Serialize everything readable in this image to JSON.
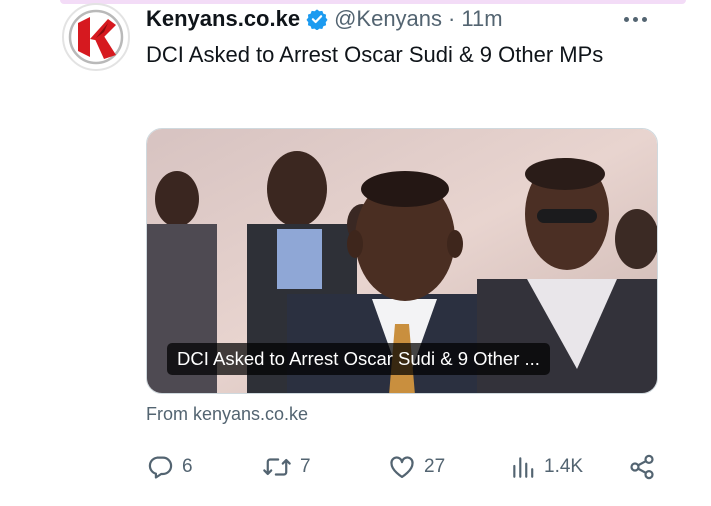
{
  "tweet": {
    "display_name": "Kenyans.co.ke",
    "handle": "@Kenyans",
    "separator": "·",
    "time": "11m",
    "text": "DCI Asked to Arrest Oscar Sudi & 9 Other MPs",
    "verified": true,
    "avatar_logo_letter": "K",
    "avatar_colors": {
      "primary": "#d6191f",
      "ring": "#e3e3e3"
    }
  },
  "card": {
    "caption": "DCI Asked to Arrest Oscar Sudi & 9 Other ...",
    "source": "From kenyans.co.ke"
  },
  "actions": {
    "replies": {
      "icon": "reply-icon",
      "count": "6"
    },
    "retweets": {
      "icon": "retweet-icon",
      "count": "7"
    },
    "likes": {
      "icon": "heart-icon",
      "count": "27"
    },
    "views": {
      "icon": "views-icon",
      "count": "1.4K"
    },
    "share": {
      "icon": "share-icon"
    }
  },
  "colors": {
    "verified": "#1d9bf0",
    "text_secondary": "#536471",
    "text_primary": "#0f1419"
  }
}
